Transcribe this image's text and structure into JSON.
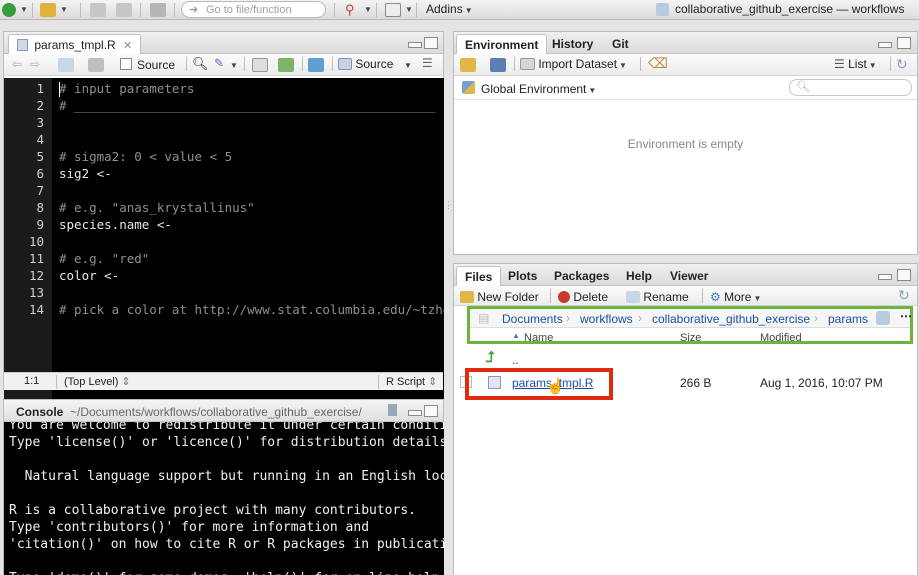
{
  "toolbar": {
    "goto_placeholder": "Go to file/function",
    "addins_label": "Addins",
    "project_label": "collaborative_github_exercise — workflows"
  },
  "editor": {
    "tab_name": "params_tmpl.R",
    "source_on_save": "Source",
    "source_button": "Source",
    "lines": [
      {
        "n": "1",
        "text": "# input parameters",
        "type": "comment"
      },
      {
        "n": "2",
        "text": "# ________________________________________________",
        "type": "comment"
      },
      {
        "n": "3",
        "text": "",
        "type": "code"
      },
      {
        "n": "4",
        "text": "",
        "type": "code"
      },
      {
        "n": "5",
        "text": "# sigma2: 0 < value < 5",
        "type": "comment"
      },
      {
        "n": "6",
        "text": "sig2 <-",
        "type": "code"
      },
      {
        "n": "7",
        "text": "",
        "type": "code"
      },
      {
        "n": "8",
        "text": "# e.g. \"anas_krystallinus\"",
        "type": "comment"
      },
      {
        "n": "9",
        "text": "species.name <-",
        "type": "code"
      },
      {
        "n": "10",
        "text": "",
        "type": "code"
      },
      {
        "n": "11",
        "text": "# e.g. \"red\"",
        "type": "comment"
      },
      {
        "n": "12",
        "text": "color <-",
        "type": "code"
      },
      {
        "n": "13",
        "text": "",
        "type": "code"
      },
      {
        "n": "14",
        "text": "# pick a color at http://www.stat.columbia.edu/~tzheng/f",
        "type": "comment"
      }
    ],
    "status_position": "1:1",
    "status_scope": "(Top Level)",
    "status_filetype": "R Script"
  },
  "console": {
    "title": "Console",
    "path": "~/Documents/workflows/collaborative_github_exercise/",
    "lines": [
      "You are welcome to redistribute it under certain conditions.",
      "Type 'license()' or 'licence()' for distribution details.",
      "",
      "  Natural language support but running in an English locale",
      "",
      "R is a collaborative project with many contributors.",
      "Type 'contributors()' for more information and",
      "'citation()' on how to cite R or R packages in publications.",
      "",
      "Type 'demo()' for some demos, 'help()' for on-line help, or"
    ]
  },
  "env_pane": {
    "tabs": [
      "Environment",
      "History",
      "Git"
    ],
    "import_dataset": "Import Dataset",
    "list_view": "List",
    "scope": "Global Environment",
    "empty_message": "Environment is empty"
  },
  "files_pane": {
    "tabs": [
      "Files",
      "Plots",
      "Packages",
      "Help",
      "Viewer"
    ],
    "new_folder": "New Folder",
    "delete": "Delete",
    "rename": "Rename",
    "more": "More",
    "breadcrumb": [
      "Documents",
      "workflows",
      "collaborative_github_exercise",
      "params"
    ],
    "columns": {
      "name": "Name",
      "size": "Size",
      "modified": "Modified"
    },
    "parent_dir": "..",
    "files": [
      {
        "name": "params_tmpl.R",
        "size": "266 B",
        "modified": "Aug 1, 2016, 10:07 PM"
      }
    ]
  },
  "colors": {
    "breadcrumb_highlight": "#6db33f",
    "file_highlight": "#e02a12",
    "link": "#1b4fa5"
  }
}
